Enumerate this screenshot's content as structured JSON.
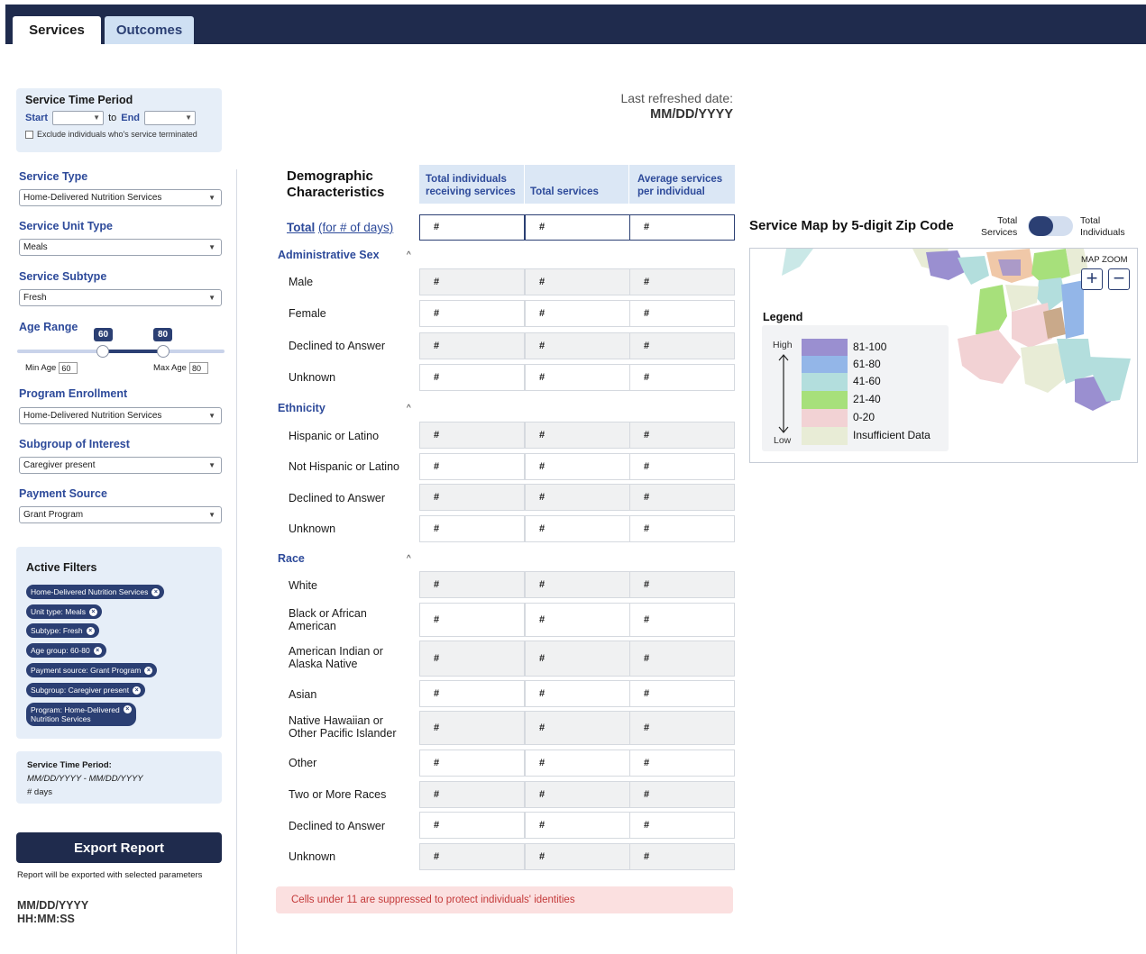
{
  "tabs": [
    {
      "label": "Services",
      "active": true
    },
    {
      "label": "Outcomes",
      "active": false
    }
  ],
  "sidebar": {
    "service_time_period": {
      "title": "Service Time Period",
      "start_label": "Start",
      "to_label": "to",
      "end_label": "End",
      "exclude_label": "Exclude individuals who's service terminated"
    },
    "service_type": {
      "label": "Service Type",
      "value": "Home-Delivered Nutrition Services"
    },
    "service_unit_type": {
      "label": "Service Unit Type",
      "value": "Meals"
    },
    "service_subtype": {
      "label": "Service Subtype",
      "value": "Fresh"
    },
    "age_range": {
      "label": "Age Range",
      "min_bubble": "60",
      "max_bubble": "80",
      "min_label": "Min Age",
      "min_value": "60",
      "max_label": "Max Age",
      "max_value": "80"
    },
    "program_enrollment": {
      "label": "Program Enrollment",
      "value": "Home-Delivered Nutrition Services"
    },
    "subgroup": {
      "label": "Subgroup of Interest",
      "value": "Caregiver present"
    },
    "payment_source": {
      "label": "Payment Source",
      "value": "Grant Program"
    },
    "active_filters": {
      "title": "Active Filters",
      "chips": [
        "Home-Delivered Nutrition Services",
        "Unit type: Meals",
        "Subtype: Fresh",
        "Age group: 60-80",
        "Payment source: Grant Program",
        "Subgroup: Caregiver present",
        "Program: Home-Delivered",
        "Nutrition Services"
      ]
    },
    "period_summary": {
      "title": "Service Time Period:",
      "range": "MM/DD/YYYY - MM/DD/YYYY",
      "days": "# days"
    },
    "export": {
      "button": "Export Report",
      "note": "Report will be exported with selected parameters",
      "date": "MM/DD/YYYY",
      "time": "HH:MM:SS"
    }
  },
  "refresh": {
    "label": "Last refreshed date:",
    "value": "MM/DD/YYYY"
  },
  "table": {
    "title_line1": "Demographic",
    "title_line2": "Characteristics",
    "col1_line1": "Total individuals",
    "col1_line2": "receiving services",
    "col2": "Total services",
    "col3_line1": "Average services",
    "col3_line2": "per individual",
    "total_label": "Total",
    "total_suffix": "(for # of days)",
    "cell_placeholder": "#",
    "caret": "^",
    "sections": {
      "sex": {
        "label": "Administrative Sex",
        "rows": [
          "Male",
          "Female",
          "Declined to Answer",
          "Unknown"
        ]
      },
      "ethnicity": {
        "label": "Ethnicity",
        "rows": [
          "Hispanic or Latino",
          "Not Hispanic or Latino",
          "Declined to Answer",
          "Unknown"
        ]
      },
      "race": {
        "label": "Race",
        "rows": [
          "White",
          "Black or African",
          "American",
          "American Indian or",
          "Alaska Native",
          "Asian",
          "Native Hawaiian or",
          "Other Pacific Islander",
          "Other",
          "Two or More Races",
          "Declined to Answer",
          "Unknown"
        ]
      }
    },
    "suppression_note": "Cells under 11 are suppressed to protect individuals' identities"
  },
  "map": {
    "title": "Service Map by 5-digit Zip Code",
    "toggle_left_1": "Total",
    "toggle_left_2": "Services",
    "toggle_right_1": "Total",
    "toggle_right_2": "Individuals",
    "zoom_label": "MAP ZOOM",
    "zoom_in": "+",
    "zoom_out": "−",
    "legend": {
      "title": "Legend",
      "high": "High",
      "low": "Low",
      "items": [
        {
          "label": "81-100",
          "color": "#9a8fd0"
        },
        {
          "label": "61-80",
          "color": "#93b6e8"
        },
        {
          "label": "41-60",
          "color": "#b3dedd"
        },
        {
          "label": "21-40",
          "color": "#a7e07b"
        },
        {
          "label": "0-20",
          "color": "#f2d2d4"
        },
        {
          "label": "Insufficient Data",
          "color": "#e8ecd6"
        }
      ]
    }
  }
}
